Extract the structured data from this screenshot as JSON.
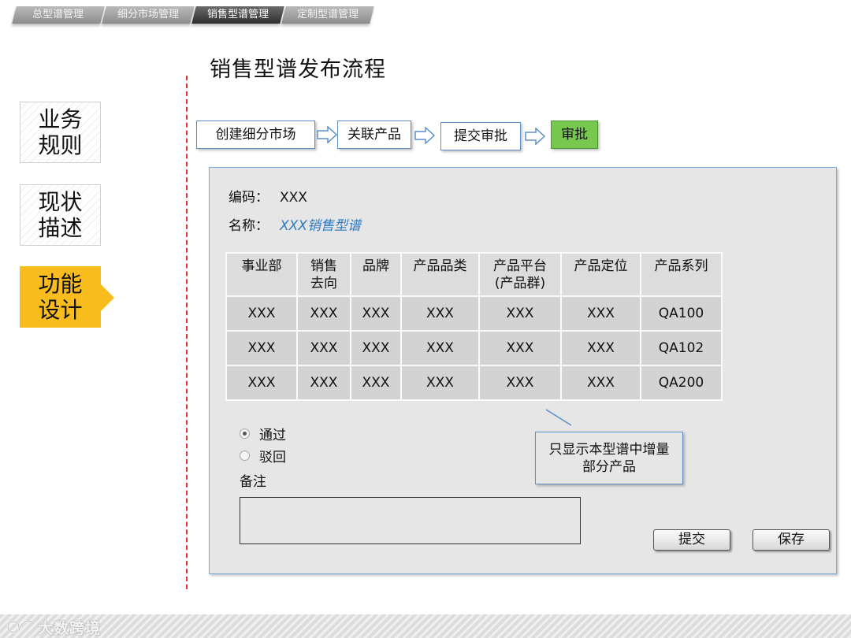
{
  "top_tabs": [
    {
      "label": "总型谱管理",
      "active": false
    },
    {
      "label": "细分市场管理",
      "active": false
    },
    {
      "label": "销售型谱管理",
      "active": true
    },
    {
      "label": "定制型谱管理",
      "active": false
    }
  ],
  "page_title": "销售型谱发布流程",
  "left_nav": [
    {
      "line1": "业务",
      "line2": "规则"
    },
    {
      "line1": "现状",
      "line2": "描述"
    },
    {
      "line1": "功能",
      "line2": "设计"
    }
  ],
  "flow": [
    "创建细分市场",
    "关联产品",
    "提交审批",
    "审批"
  ],
  "form": {
    "code_label": "编码：",
    "code_value": "XXX",
    "name_label": "名称：",
    "name_value": "XXX销售型谱"
  },
  "table": {
    "headers": [
      {
        "line1": "事业部",
        "line2": ""
      },
      {
        "line1": "销售",
        "line2": "去向"
      },
      {
        "line1": "品牌",
        "line2": ""
      },
      {
        "line1": "产品品类",
        "line2": ""
      },
      {
        "line1": "产品平台",
        "line2": "(产品群)"
      },
      {
        "line1": "产品定位",
        "line2": ""
      },
      {
        "line1": "产品系列",
        "line2": ""
      }
    ],
    "rows": [
      [
        "XXX",
        "XXX",
        "XXX",
        "XXX",
        "XXX",
        "XXX",
        "QA100"
      ],
      [
        "XXX",
        "XXX",
        "XXX",
        "XXX",
        "XXX",
        "XXX",
        "QA102"
      ],
      [
        "XXX",
        "XXX",
        "XXX",
        "XXX",
        "XXX",
        "XXX",
        "QA200"
      ]
    ]
  },
  "callout": {
    "line1": "只显示本型谱中增量",
    "line2": "部分产品"
  },
  "radios": {
    "approve": "通过",
    "reject": "驳回",
    "selected": "approve"
  },
  "note_label": "备注",
  "note_value": "",
  "buttons": {
    "submit": "提交",
    "save": "保存"
  },
  "watermark": "大数跨境",
  "colors": {
    "accent": "#f8bc1c",
    "flow_border": "#5b8fc8",
    "approve_step": "#78c850",
    "divider": "#e03030",
    "link": "#2e7bc4"
  }
}
